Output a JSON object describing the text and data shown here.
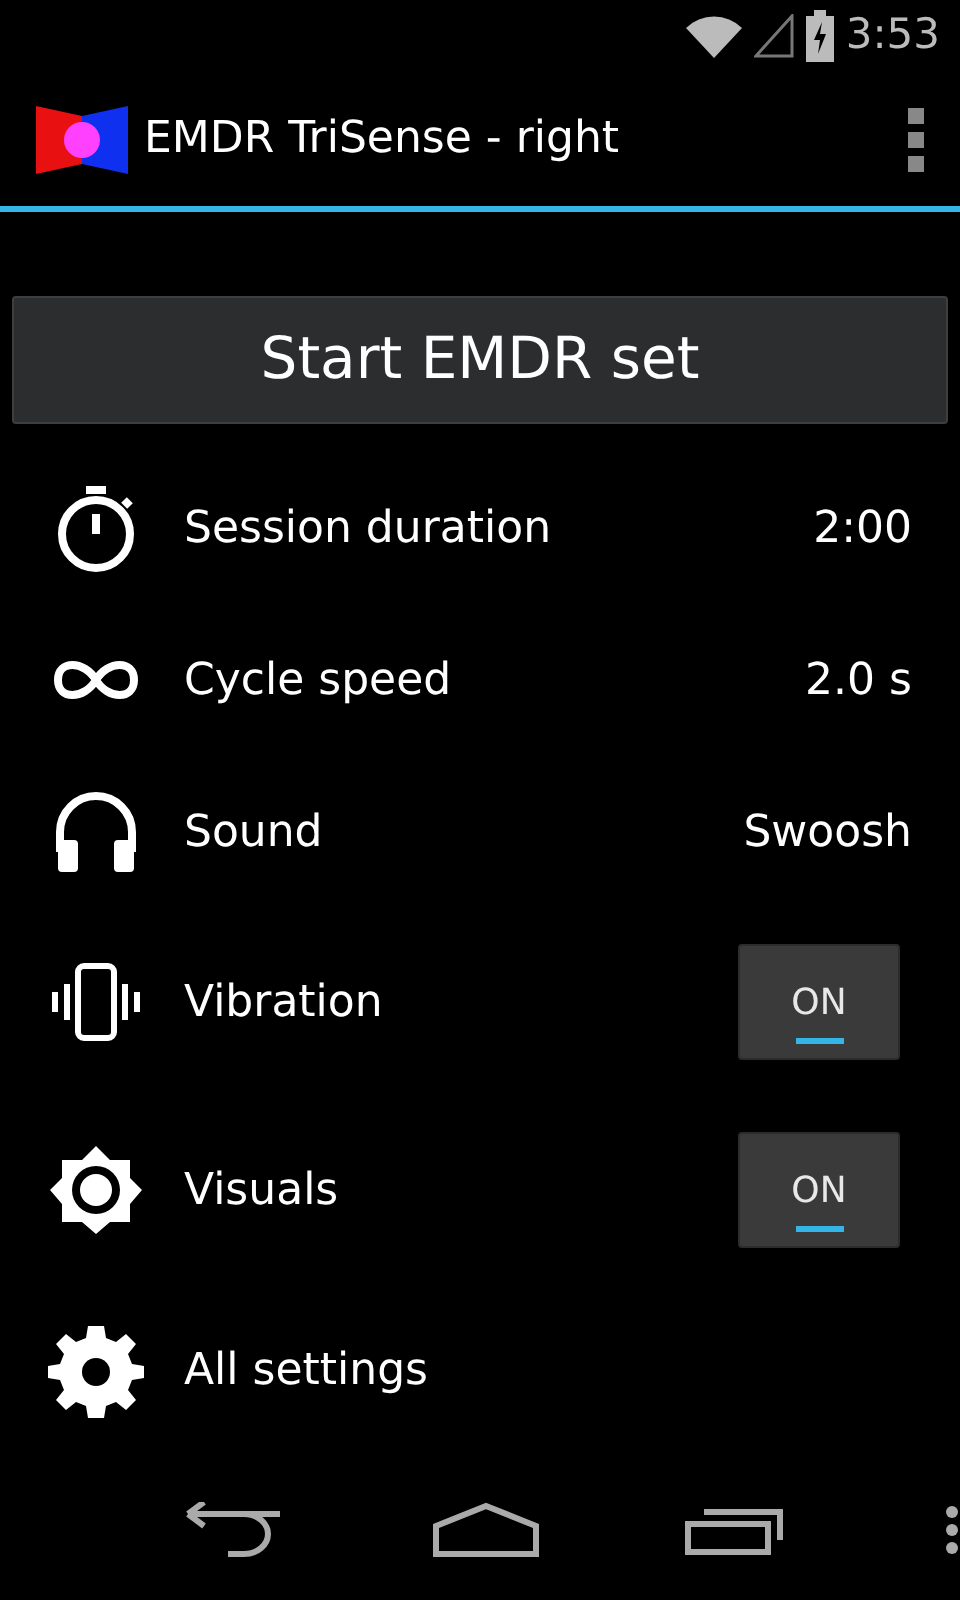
{
  "status_bar": {
    "time": "3:53"
  },
  "action_bar": {
    "title": "EMDR TriSense - right"
  },
  "start_button": {
    "label": "Start EMDR set"
  },
  "settings": [
    {
      "kind": "value",
      "label": "Session duration",
      "value": "2:00"
    },
    {
      "kind": "value",
      "label": "Cycle speed",
      "value": "2.0 s"
    },
    {
      "kind": "value",
      "label": "Sound",
      "value": "Swoosh"
    },
    {
      "kind": "toggle",
      "label": "Vibration",
      "state_text": "ON",
      "on": true
    },
    {
      "kind": "toggle",
      "label": "Visuals",
      "state_text": "ON",
      "on": true
    },
    {
      "kind": "link",
      "label": "All settings"
    }
  ]
}
